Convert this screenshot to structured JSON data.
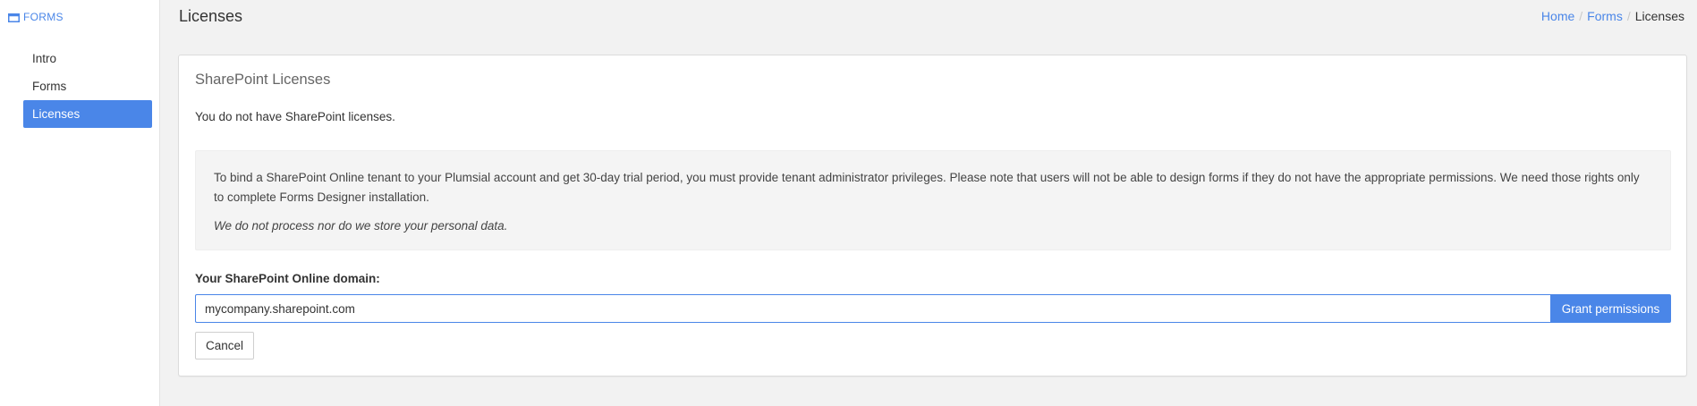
{
  "sidebar": {
    "header": {
      "icon": "window-icon",
      "label": "FORMS"
    },
    "items": [
      {
        "label": "Intro",
        "active": false
      },
      {
        "label": "Forms",
        "active": false
      },
      {
        "label": "Licenses",
        "active": true
      }
    ]
  },
  "header": {
    "title": "Licenses",
    "breadcrumb": [
      "Home",
      "Forms",
      "Licenses"
    ]
  },
  "panel": {
    "title": "SharePoint Licenses",
    "status": "You do not have SharePoint licenses.",
    "info": {
      "text": "To bind a SharePoint Online tenant to your Plumsial account and get 30-day trial period, you must provide tenant administrator privileges. Please note that users will not be able to design forms if they do not have the appropriate permissions. We need those rights only to complete Forms Designer installation.",
      "note": "We do not process nor do we store your personal data."
    },
    "domain": {
      "label": "Your SharePoint Online domain:",
      "value": "mycompany.sharepoint.com",
      "placeholder": "",
      "button": "Grant permissions"
    },
    "cancel": "Cancel"
  },
  "colors": {
    "accent": "#4a86e8",
    "background": "#f2f2f2",
    "info_background": "#f4f4f4"
  }
}
